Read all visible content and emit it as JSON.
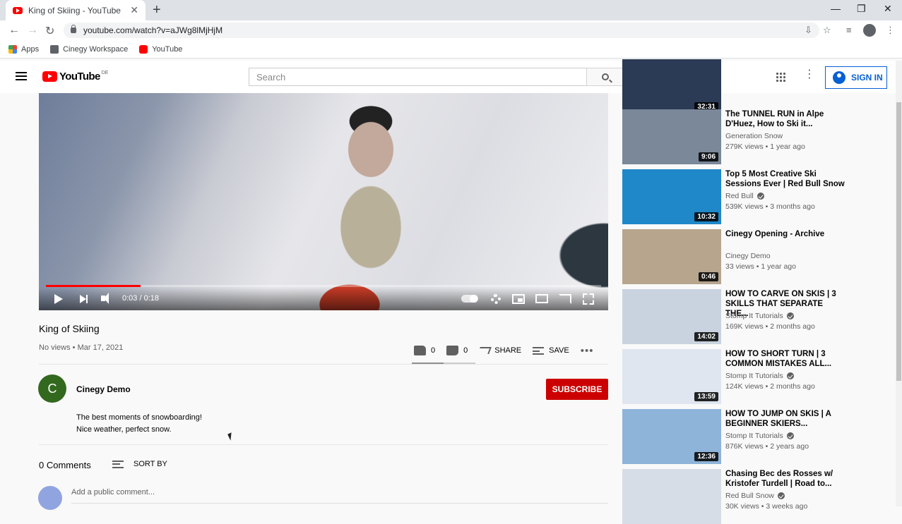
{
  "browser": {
    "tab_title": "King of Skiing - YouTube",
    "url": "youtube.com/watch?v=aJWg8lMjHjM",
    "bookmarks": [
      {
        "label": "Apps",
        "icon": "apps-icon"
      },
      {
        "label": "Cinegy Workspace",
        "icon": "workspace-icon"
      },
      {
        "label": "YouTube",
        "icon": "youtube-icon"
      }
    ]
  },
  "header": {
    "logo_text": "YouTube",
    "logo_country": "DE",
    "search_placeholder": "Search",
    "signin_label": "SIGN IN"
  },
  "player": {
    "time": "0:03 / 0:18",
    "progress": 0.17
  },
  "video": {
    "title": "King of Skiing",
    "meta": "No views • Mar 17, 2021",
    "likes": "0",
    "dislikes": "0",
    "share_label": "SHARE",
    "save_label": "SAVE"
  },
  "channel": {
    "initial": "C",
    "name": "Cinegy Demo",
    "subscribe_label": "SUBSCRIBE",
    "description_line1": "The best moments of snowboarding!",
    "description_line2": "Nice weather, perfect snow."
  },
  "comments": {
    "count_label": "0 Comments",
    "sort_label": "SORT BY",
    "input_placeholder": "Add a public comment..."
  },
  "recommendations": [
    {
      "title": "",
      "channel": "",
      "meta": "",
      "duration": "32:31",
      "verified": false,
      "thumb": "#2b3a55"
    },
    {
      "title": "The TUNNEL RUN in Alpe D'Huez, How to Ski it...",
      "channel": "Generation Snow",
      "meta": "279K views • 1 year ago",
      "duration": "9:06",
      "verified": false,
      "thumb": "#7a8899"
    },
    {
      "title": "Top 5 Most Creative Ski Sessions Ever | Red Bull Snow",
      "channel": "Red Bull",
      "meta": "539K views • 3 months ago",
      "duration": "10:32",
      "verified": true,
      "thumb": "#1e88c9"
    },
    {
      "title": "Cinegy Opening - Archive",
      "channel": "Cinegy Demo",
      "meta": "33 views • 1 year ago",
      "duration": "0:46",
      "verified": false,
      "thumb": "#b7a58e"
    },
    {
      "title": "HOW TO CARVE ON SKIS | 3 SKILLS THAT SEPARATE THE...",
      "channel": "Stomp It Tutorials",
      "meta": "169K views • 2 months ago",
      "duration": "14:02",
      "verified": true,
      "thumb": "#c9d3df"
    },
    {
      "title": "HOW TO SHORT TURN | 3 COMMON MISTAKES ALL...",
      "channel": "Stomp It Tutorials",
      "meta": "124K views • 2 months ago",
      "duration": "13:59",
      "verified": true,
      "thumb": "#dfe6ef"
    },
    {
      "title": "HOW TO JUMP ON SKIS | A BEGINNER SKIERS...",
      "channel": "Stomp It Tutorials",
      "meta": "876K views • 2 years ago",
      "duration": "12:36",
      "verified": true,
      "thumb": "#8fb4da"
    },
    {
      "title": "Chasing Bec des Rosses w/ Kristofer Turdell | Road to...",
      "channel": "Red Bull Snow",
      "meta": "30K views • 3 weeks ago",
      "duration": "",
      "verified": true,
      "thumb": "#d7dde6"
    }
  ],
  "colors": {
    "brand_red": "#ff0000",
    "subscribe_red": "#cc0000",
    "link_blue": "#065fd4",
    "channel_avatar": "#33691e"
  }
}
